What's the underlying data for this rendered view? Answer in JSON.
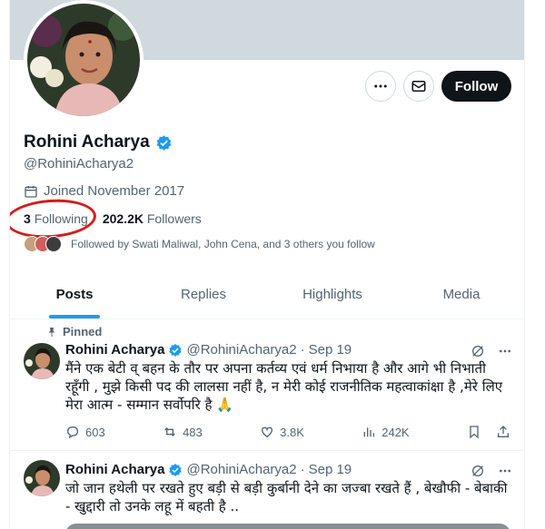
{
  "profile": {
    "name": "Rohini Acharya",
    "handle": "@RohiniAcharya2",
    "joined": "Joined November 2017",
    "following_count": "3",
    "following_label": "Following",
    "followers_count": "202.2K",
    "followers_label": "Followers",
    "followed_by": "Followed by Swati Maliwal, John Cena, and 3 others you follow",
    "verified_color": "#1d9bf0"
  },
  "actions": {
    "more_icon": "more-horizontal-icon",
    "message_icon": "envelope-icon",
    "follow_label": "Follow"
  },
  "tabs": [
    {
      "label": "Posts",
      "active": true
    },
    {
      "label": "Replies",
      "active": false
    },
    {
      "label": "Highlights",
      "active": false
    },
    {
      "label": "Media",
      "active": false
    }
  ],
  "tweets": [
    {
      "pinned_label": "Pinned",
      "name": "Rohini Acharya",
      "handle": "@RohiniAcharya2",
      "date": "Sep 19",
      "text": "मैंने एक बेटी व् बहन के तौर पर अपना कर्तव्य एवं धर्म निभाया है और आगे भी निभाती रहूँगी , मुझे किसी पद की लालसा नहीं है, न मेरी कोई राजनीतिक महत्वाकांक्षा है ,मेरे लिए मेरा आत्म - सम्मान सर्वोपरि है 🙏",
      "replies": "603",
      "reposts": "483",
      "likes": "3.8K",
      "views": "242K"
    },
    {
      "name": "Rohini Acharya",
      "handle": "@RohiniAcharya2",
      "date": "Sep 19",
      "text": "जो जान हथेली पर रखते हुए बड़ी से बड़ी कुर्बानी देने का जज्बा रखते हैं , बेखौफी - बेबाकी - खुद्दारी तो उनके लहू में बहती है .."
    }
  ]
}
